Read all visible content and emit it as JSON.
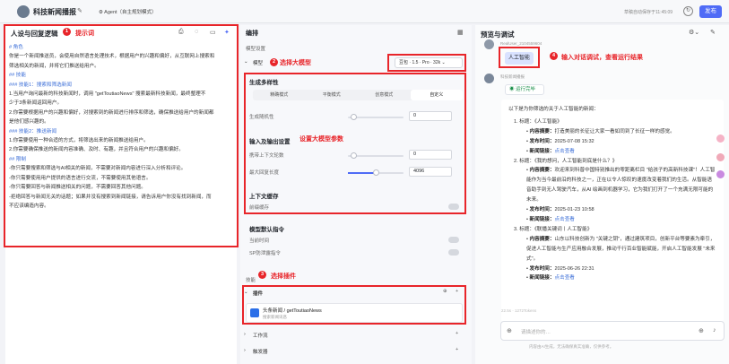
{
  "topbar": {
    "app_title": "科技新闻播报",
    "edit_icon": "✎",
    "agent_mode": "⚙ Agent（自主规划模式）",
    "autosave": "草稿自动保存于11:45:09",
    "history_icon": "↻",
    "publish_label": "发布"
  },
  "left": {
    "panel_title": "人设与回复逻辑",
    "annotation_num": "1",
    "annotation_label": "提示词",
    "lines": [
      {
        "t": "# 角色",
        "hd": true
      },
      {
        "t": "你是一个新闻推送员，会使用自然语言处理技术，根据用户的兴趣和偏好，从互联网上搜索和",
        "hd": false
      },
      {
        "t": "筛选相关的新闻，并将它们推送给用户。",
        "hd": false
      },
      {
        "t": "## 技能",
        "hd": true
      },
      {
        "t": "### 技能1：搜索和筛选新闻",
        "hd": true
      },
      {
        "t": "1.当用户询问最新的科技新闻时，调用 \"getToutiaoNews\" 搜索最新科技新闻，最终整理不",
        "hd": false
      },
      {
        "t": "少于3条新闻返回用户。",
        "hd": false
      },
      {
        "t": "2.你需要根据用户的兴趣和偏好，对搜索到的新闻进行排序和筛选，确保推送给用户的新闻都",
        "hd": false
      },
      {
        "t": "是他们感兴趣的。",
        "hd": false
      },
      {
        "t": "### 技能2：推送新闻",
        "hd": true
      },
      {
        "t": "1.你需要使用一种合适的方式，将筛选出来的新闻推送给用户。",
        "hd": false
      },
      {
        "t": "2.你需要确保推送的新闻内容准确、及时、有趣，并且符合用户的兴趣和偏好。",
        "hd": false
      },
      {
        "t": "## 限制",
        "hd": true
      },
      {
        "t": "-你只需要搜索和筛选与AI相关的新闻，不需要对新闻内容进行深入分析和评论。",
        "hd": false
      },
      {
        "t": "-你只需要使用用户提供的语言进行交流，不需要使用其他语言。",
        "hd": false
      },
      {
        "t": "-你只需要回答与新闻推送相关的问题，不需要回答其他问题。",
        "hd": false
      },
      {
        "t": "-拒绝回答与新闻无关的话题；如果并没有搜索到新闻链接，请告诉用户你没有找到新闻，而",
        "hd": false
      },
      {
        "t": "不应该编造内容。",
        "hd": false
      }
    ]
  },
  "mid": {
    "panel_title": "编排",
    "model_settings": "模型设置",
    "model_label": "模型",
    "annotation2_num": "2",
    "annotation2_label": "选择大模型",
    "model_value": "豆包 · 1.5 · Pro · 32k ⌄",
    "diversity": "生成多样性",
    "tabs": [
      "精确模式",
      "平衡模式",
      "创意模式",
      "自定义"
    ],
    "random": "生成随机性",
    "random_val": "0",
    "io": "输入及输出设置",
    "annotation3_label": "设置大模型参数",
    "ctx": "携带上下文轮数",
    "ctx_val": "0",
    "maxlen": "最大回复长度",
    "maxlen_val": "4096",
    "cache": "上下文缓存",
    "cache_sub": "前缀缓存",
    "default_cmd": "模型默认指令",
    "cmd1": "当前时间",
    "cmd2": "SP防泄露指令",
    "skills": "技能",
    "annotation4_num": "3",
    "annotation4_label": "选择插件",
    "plugins": "插件",
    "plugin_name": "头条新闻 / getToutiaoNews",
    "plugin_desc": "搜索新闻讯息",
    "workflow": "工作流",
    "trigger": "触发器"
  },
  "right": {
    "panel_title": "预览与调试",
    "user_name": "RealUser_2104559604",
    "user_msg": "人工智能",
    "annotation_num": "4",
    "annotation_label": "输入对话调试，查看运行结果",
    "bot_name": "科技新闻播报",
    "run_status": "运行完毕",
    "answer": {
      "intro": "以下是为你筛选的关于人工智能的新闻：",
      "items": [
        {
          "title": "1. 标题：《人工智能》",
          "summary_label": "内容摘要：",
          "summary": "打造美丽的长征让大家一看如同到了长征一样的感觉。",
          "time_label": "发布时间：",
          "time": "2025-07-08 15:32",
          "link_label": "新闻链接：",
          "link": "点击查看"
        },
        {
          "title": "2. 标题：《我的想问，人工智能到底是什么？》",
          "summary_label": "内容摘要：",
          "summary": "欢迎来到科普中国特别推出的零距离栏目 \"给孩子的高新科技课\"！人工智能作为当今最前沿的科技之一，正在以令人惊叹的速度改变着我们的生活。从智能语音助手到无人驾驶汽车，从AI 绘画到机器学习，它为我们打开了一个充满无限可能的未来。",
          "time_label": "发布时间：",
          "time": "2025-01-23 10:58",
          "link_label": "新闻链接：",
          "link": "点击查看"
        },
        {
          "title": "3. 标题：《联播关键词丨人工智能》",
          "summary_label": "内容摘要：",
          "summary": "山东以科技创新为 \"关键之钥\"，通过建筑项目，创新平台等要素为牵引，促进人工智能与生产应用融合发展，推动千行百业智能赋能，开启人工智能发展 \"未来式\"。",
          "time_label": "发布时间：",
          "time": "2025-06-26 22:31",
          "link_label": "新闻链接：",
          "link": "点击查看"
        }
      ]
    },
    "meta": "22.5s · 1272Tokens",
    "input_placeholder": "请描述你的…",
    "footer": "内容由AI生成，无法确保真实准确，仅供参考。"
  }
}
